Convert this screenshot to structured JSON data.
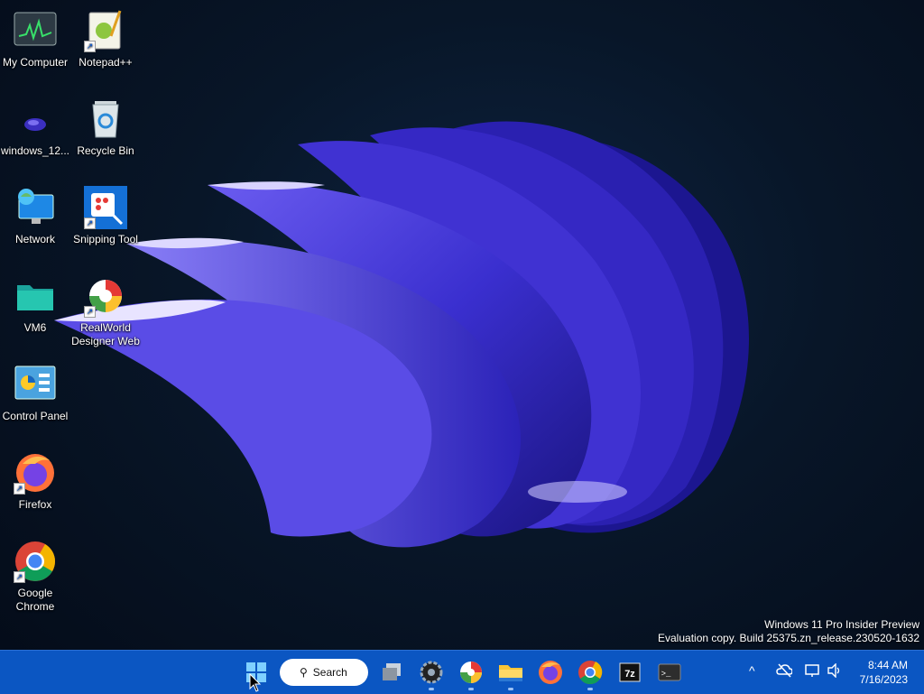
{
  "desktop": {
    "icons": [
      {
        "label": "My Computer",
        "icon": "task-manager-icon"
      },
      {
        "label": "Notepad++",
        "icon": "notepadpp-icon"
      },
      {
        "label": "windows_12...",
        "icon": "app-shortcut-icon"
      },
      {
        "label": "Recycle Bin",
        "icon": "recycle-bin-icon"
      },
      {
        "label": "Network",
        "icon": "network-icon"
      },
      {
        "label": "Snipping Tool",
        "icon": "snipping-tool-icon"
      },
      {
        "label": "VM6",
        "icon": "folder-icon"
      },
      {
        "label": "RealWorld Designer Web",
        "icon": "realworld-icon"
      },
      {
        "label": "Control Panel",
        "icon": "control-panel-icon"
      },
      {
        "label": "Firefox",
        "icon": "firefox-icon"
      },
      {
        "label": "Google Chrome",
        "icon": "chrome-icon"
      }
    ],
    "shortcut_arrow": "↗"
  },
  "watermark": {
    "line1": "Windows 11 Pro Insider Preview",
    "line2": "Evaluation copy. Build 25375.zn_release.230520-1632"
  },
  "taskbar": {
    "search_label": "Search",
    "pinned": [
      "start-icon",
      "task-view-icon",
      "settings-icon",
      "realworld-icon",
      "file-explorer-icon",
      "firefox-icon",
      "chrome-icon",
      "7zip-icon",
      "terminal-icon"
    ],
    "sevenzip_label": "7z",
    "terminal_label": ">_",
    "tray": {
      "chevron": "^"
    },
    "clock": {
      "time": "8:44 AM",
      "date": "7/16/2023"
    }
  },
  "colors": {
    "taskbar": "#0b56c2",
    "accent": "#4a3fd8"
  }
}
